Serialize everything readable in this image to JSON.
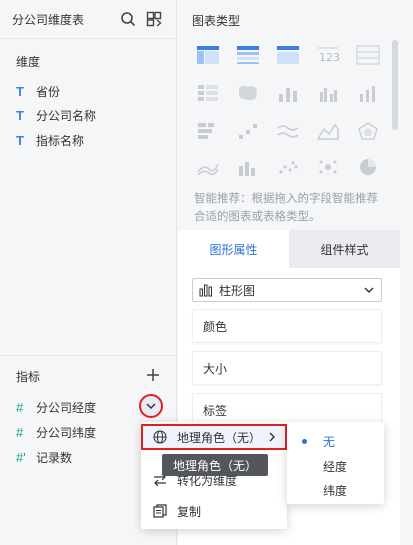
{
  "left_panel": {
    "title": "分公司维度表",
    "dimension_section": "维度",
    "dimensions": [
      {
        "type_icon": "T",
        "label": "省份"
      },
      {
        "type_icon": "T",
        "label": "分公司名称"
      },
      {
        "type_icon": "T",
        "label": "指标名称"
      }
    ],
    "measure_section": "指标",
    "measures": [
      {
        "type_icon": "#",
        "label": "分公司经度"
      },
      {
        "type_icon": "#",
        "label": "分公司纬度"
      },
      {
        "type_icon": "#'",
        "label": "记录数"
      }
    ]
  },
  "right_panel": {
    "title": "图表类型",
    "recommend_text": "智能推荐：根据拖入的字段智能推荐合适的图表或表格类型。",
    "tabs": [
      {
        "label": "图形属性",
        "active": true
      },
      {
        "label": "组件样式",
        "active": false
      }
    ],
    "chart_select": {
      "value": "柱形图",
      "icon": "bar-chart-icon"
    },
    "property_cards": [
      "颜色",
      "大小",
      "标签"
    ]
  },
  "context_menu": {
    "items": [
      {
        "label": "地理角色（无）",
        "icon": "globe-icon",
        "has_submenu": true
      },
      {
        "label": "转化为维度",
        "icon": "swap-icon"
      },
      {
        "label": "复制",
        "icon": "copy-icon"
      }
    ],
    "submenu": [
      {
        "label": "无",
        "selected": true
      },
      {
        "label": "经度",
        "selected": false
      },
      {
        "label": "纬度",
        "selected": false
      }
    ],
    "tooltip": "地理角色（无）"
  },
  "colors": {
    "accent": "#2a6fdb",
    "highlight_red": "#e02020",
    "field_text_blue": "#3d7fe3",
    "measure_green": "#13a380"
  }
}
